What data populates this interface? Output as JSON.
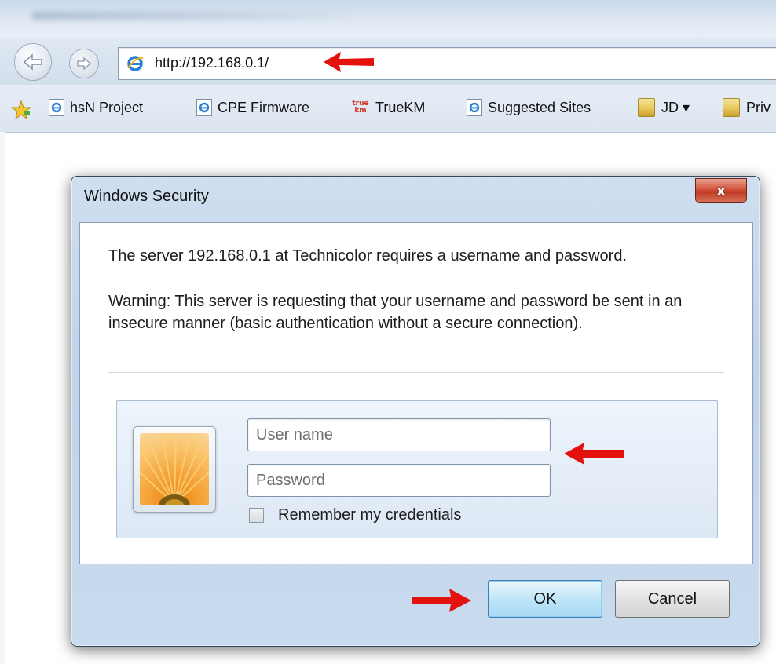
{
  "browser": {
    "address_url": "http://192.168.0.1/",
    "favorites": [
      {
        "label": "hsN Project",
        "icon": "ie-page-icon"
      },
      {
        "label": "CPE Firmware",
        "icon": "ie-page-icon"
      },
      {
        "label": "TrueKM",
        "icon": "truekm-icon"
      },
      {
        "label": "Suggested Sites",
        "icon": "ie-page-icon"
      },
      {
        "label": "JD ▾",
        "icon": "folder-icon"
      },
      {
        "label": "Priv",
        "icon": "folder-icon"
      }
    ],
    "truekm_icon_text": {
      "top": "true",
      "bottom": "km"
    }
  },
  "dialog": {
    "title": "Windows Security",
    "close_glyph": "x",
    "message": "The server 192.168.0.1 at Technicolor requires a username and password.",
    "warning": "Warning: This server is requesting that your username and password be sent in an insecure manner (basic authentication without a secure connection).",
    "username_placeholder": "User name",
    "password_placeholder": "Password",
    "remember_label": "Remember my credentials",
    "ok_label": "OK",
    "cancel_label": "Cancel"
  },
  "colors": {
    "annotation_arrow": "#e4120f",
    "ok_border": "#3c7fb1",
    "close_button": "#c03a22"
  }
}
